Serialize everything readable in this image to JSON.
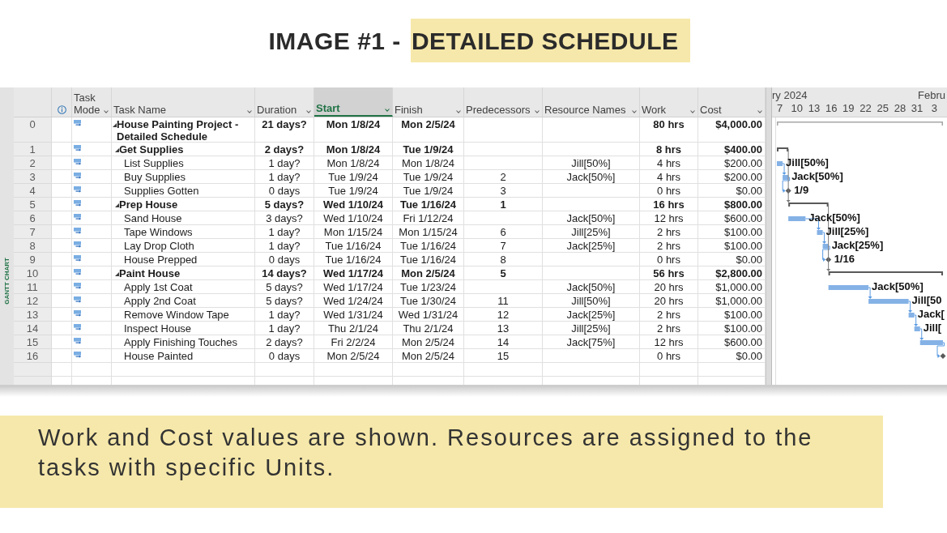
{
  "title": {
    "text": "IMAGE #1 -",
    "highlight": "DETAILED SCHEDULE"
  },
  "view_bar": {
    "label": "GANTT CHART"
  },
  "table": {
    "columns": [
      {
        "kind": "indicators",
        "selected": false
      },
      {
        "kind": "mode",
        "label": "Task Mode",
        "selected": false
      },
      {
        "kind": "name",
        "label": "Task Name",
        "selected": false
      },
      {
        "kind": "duration",
        "label": "Duration",
        "selected": false
      },
      {
        "kind": "start",
        "label": "Start",
        "selected": true
      },
      {
        "kind": "finish",
        "label": "Finish",
        "selected": false
      },
      {
        "kind": "predecessors",
        "label": "Predecessors",
        "selected": false
      },
      {
        "kind": "resources",
        "label": "Resource Names",
        "selected": false
      },
      {
        "kind": "work",
        "label": "Work",
        "selected": false
      },
      {
        "kind": "cost",
        "label": "Cost",
        "selected": false
      }
    ],
    "rows": [
      {
        "id": "0",
        "auto_scheduled": true,
        "kind": "project",
        "expanded": true,
        "name": "House Painting Project - Detailed Schedule",
        "duration": "21 days?",
        "start": "Mon 1/8/24",
        "finish": "Mon 2/5/24",
        "work": "80 hrs",
        "cost": "$4,000.00",
        "children": [
          {
            "id": "1",
            "auto_scheduled": true,
            "kind": "summary",
            "expanded": true,
            "name": "Get Supplies",
            "duration": "2 days?",
            "start": "Mon 1/8/24",
            "finish": "Tue 1/9/24",
            "work": "8 hrs",
            "cost": "$400.00",
            "children": [
              {
                "id": "2",
                "auto_scheduled": true,
                "kind": "task",
                "name": "List Supplies",
                "duration": "1 day?",
                "start": "Mon 1/8/24",
                "finish": "Mon 1/8/24",
                "resources": "Jill[50%]",
                "work": "4 hrs",
                "cost": "$200.00",
                "bar_label": "Jill[50%]"
              },
              {
                "id": "3",
                "auto_scheduled": true,
                "kind": "task",
                "name": "Buy Supplies",
                "duration": "1 day?",
                "start": "Tue 1/9/24",
                "finish": "Tue 1/9/24",
                "predecessors": "2",
                "resources": "Jack[50%]",
                "work": "4 hrs",
                "cost": "$200.00",
                "bar_label": "Jack[50%]"
              },
              {
                "id": "4",
                "auto_scheduled": true,
                "kind": "milestone",
                "name": "Supplies Gotten",
                "duration": "0 days",
                "start": "Tue 1/9/24",
                "finish": "Tue 1/9/24",
                "predecessors": "3",
                "work": "0 hrs",
                "cost": "$0.00",
                "bar_label": "1/9"
              }
            ]
          },
          {
            "id": "5",
            "auto_scheduled": true,
            "kind": "summary",
            "expanded": true,
            "name": "Prep House",
            "duration": "5 days?",
            "start": "Wed 1/10/24",
            "finish": "Tue 1/16/24",
            "predecessors": "1",
            "work": "16 hrs",
            "cost": "$800.00",
            "children": [
              {
                "id": "6",
                "auto_scheduled": true,
                "kind": "task",
                "name": "Sand House",
                "duration": "3 days?",
                "start": "Wed 1/10/24",
                "finish": "Fri 1/12/24",
                "resources": "Jack[50%]",
                "work": "12 hrs",
                "cost": "$600.00",
                "bar_label": "Jack[50%]"
              },
              {
                "id": "7",
                "auto_scheduled": true,
                "kind": "task",
                "name": "Tape Windows",
                "duration": "1 day?",
                "start": "Mon 1/15/24",
                "finish": "Mon 1/15/24",
                "predecessors": "6",
                "resources": "Jill[25%]",
                "work": "2 hrs",
                "cost": "$100.00",
                "bar_label": "Jill[25%]"
              },
              {
                "id": "8",
                "auto_scheduled": true,
                "kind": "task",
                "name": "Lay Drop Cloth",
                "duration": "1 day?",
                "start": "Tue 1/16/24",
                "finish": "Tue 1/16/24",
                "predecessors": "7",
                "resources": "Jack[25%]",
                "work": "2 hrs",
                "cost": "$100.00",
                "bar_label": "Jack[25%]"
              },
              {
                "id": "9",
                "auto_scheduled": true,
                "kind": "milestone",
                "name": "House Prepped",
                "duration": "0 days",
                "start": "Tue 1/16/24",
                "finish": "Tue 1/16/24",
                "predecessors": "8",
                "work": "0 hrs",
                "cost": "$0.00",
                "bar_label": "1/16"
              }
            ]
          },
          {
            "id": "10",
            "auto_scheduled": true,
            "kind": "summary",
            "expanded": true,
            "name": "Paint House",
            "duration": "14 days?",
            "start": "Wed 1/17/24",
            "finish": "Mon 2/5/24",
            "predecessors": "5",
            "work": "56 hrs",
            "cost": "$2,800.00",
            "children": [
              {
                "id": "11",
                "auto_scheduled": true,
                "kind": "task",
                "name": "Apply 1st Coat",
                "duration": "5 days?",
                "start": "Wed 1/17/24",
                "finish": "Tue 1/23/24",
                "resources": "Jack[50%]",
                "work": "20 hrs",
                "cost": "$1,000.00",
                "bar_label": "Jack[50%]"
              },
              {
                "id": "12",
                "auto_scheduled": true,
                "kind": "task",
                "name": "Apply 2nd Coat",
                "duration": "5 days?",
                "start": "Wed 1/24/24",
                "finish": "Tue 1/30/24",
                "predecessors": "11",
                "resources": "Jill[50%]",
                "work": "20 hrs",
                "cost": "$1,000.00",
                "bar_label": "Jill[50"
              },
              {
                "id": "13",
                "auto_scheduled": true,
                "kind": "task",
                "name": "Remove Window Tape",
                "duration": "1 day?",
                "start": "Wed 1/31/24",
                "finish": "Wed 1/31/24",
                "predecessors": "12",
                "resources": "Jack[25%]",
                "work": "2 hrs",
                "cost": "$100.00",
                "bar_label": "Jack["
              },
              {
                "id": "14",
                "auto_scheduled": true,
                "kind": "task",
                "name": "Inspect House",
                "duration": "1 day?",
                "start": "Thu 2/1/24",
                "finish": "Thu 2/1/24",
                "predecessors": "13",
                "resources": "Jill[25%]",
                "work": "2 hrs",
                "cost": "$100.00",
                "bar_label": "Jill["
              },
              {
                "id": "15",
                "auto_scheduled": true,
                "kind": "task",
                "name": "Apply Finishing Touches",
                "duration": "2 days?",
                "start": "Fri 2/2/24",
                "finish": "Mon 2/5/24",
                "predecessors": "14",
                "resources": "Jack[75%]",
                "work": "12 hrs",
                "cost": "$600.00"
              },
              {
                "id": "16",
                "auto_scheduled": true,
                "kind": "milestone",
                "name": "House Painted",
                "duration": "0 days",
                "start": "Mon 2/5/24",
                "finish": "Mon 2/5/24",
                "predecessors": "15",
                "work": "0 hrs",
                "cost": "$0.00"
              }
            ]
          }
        ]
      }
    ]
  },
  "gantt": {
    "months": [
      "ry 2024",
      "Febru"
    ],
    "days": [
      "7",
      "10",
      "13",
      "16",
      "19",
      "22",
      "25",
      "28",
      "31",
      "3"
    ]
  },
  "caption": "Work and Cost values are shown. Resources are assigned to the tasks with specific Units."
}
